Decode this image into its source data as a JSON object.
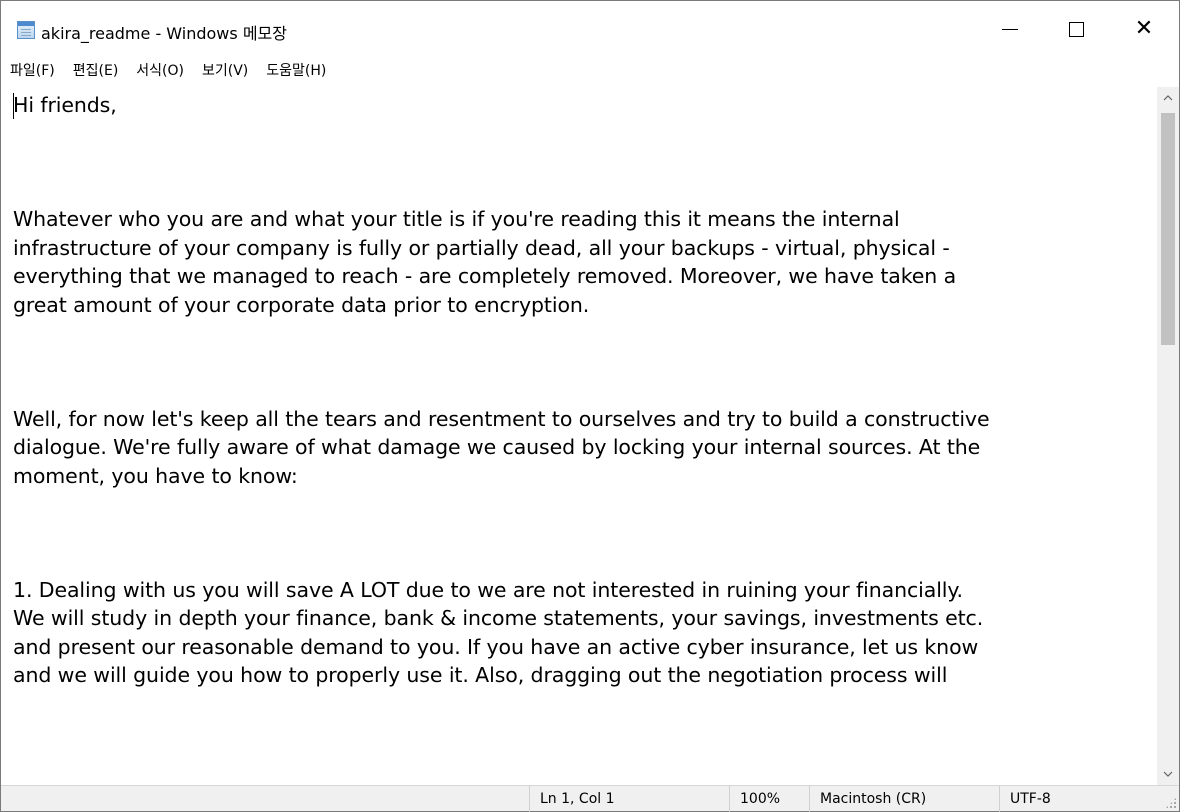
{
  "window": {
    "title": "akira_readme - Windows 메모장",
    "app_icon": "notepad-icon",
    "controls": {
      "minimize_icon": "minimize-icon",
      "maximize_icon": "maximize-icon",
      "close_icon": "close-icon",
      "close_glyph": "✕"
    }
  },
  "menu": {
    "items": [
      {
        "label": "파일(F)"
      },
      {
        "label": "편집(E)"
      },
      {
        "label": "서식(O)"
      },
      {
        "label": "보기(V)"
      },
      {
        "label": "도움말(H)"
      }
    ]
  },
  "editor": {
    "text": "Hi friends,\n\n\n\nWhatever who you are and what your title is if you're reading this it means the internal\ninfrastructure of your company is fully or partially dead, all your backups - virtual, physical -\neverything that we managed to reach - are completely removed. Moreover, we have taken a\ngreat amount of your corporate data prior to encryption.\n\n\n\nWell, for now let's keep all the tears and resentment to ourselves and try to build a constructive\ndialogue. We're fully aware of what damage we caused by locking your internal sources. At the\nmoment, you have to know:\n\n\n\n1. Dealing with us you will save A LOT due to we are not interested in ruining your financially.\nWe will study in depth your finance, bank & income statements, your savings, investments etc.\nand present our reasonable demand to you. If you have an active cyber insurance, let us know\nand we will guide you how to properly use it. Also, dragging out the negotiation process will"
  },
  "scrollbar": {
    "up_glyph": "^",
    "down_glyph": "v",
    "position_fraction": 0.0
  },
  "status": {
    "position": "Ln 1, Col 1",
    "zoom": "100%",
    "line_ending": "Macintosh (CR)",
    "encoding": "UTF-8"
  }
}
